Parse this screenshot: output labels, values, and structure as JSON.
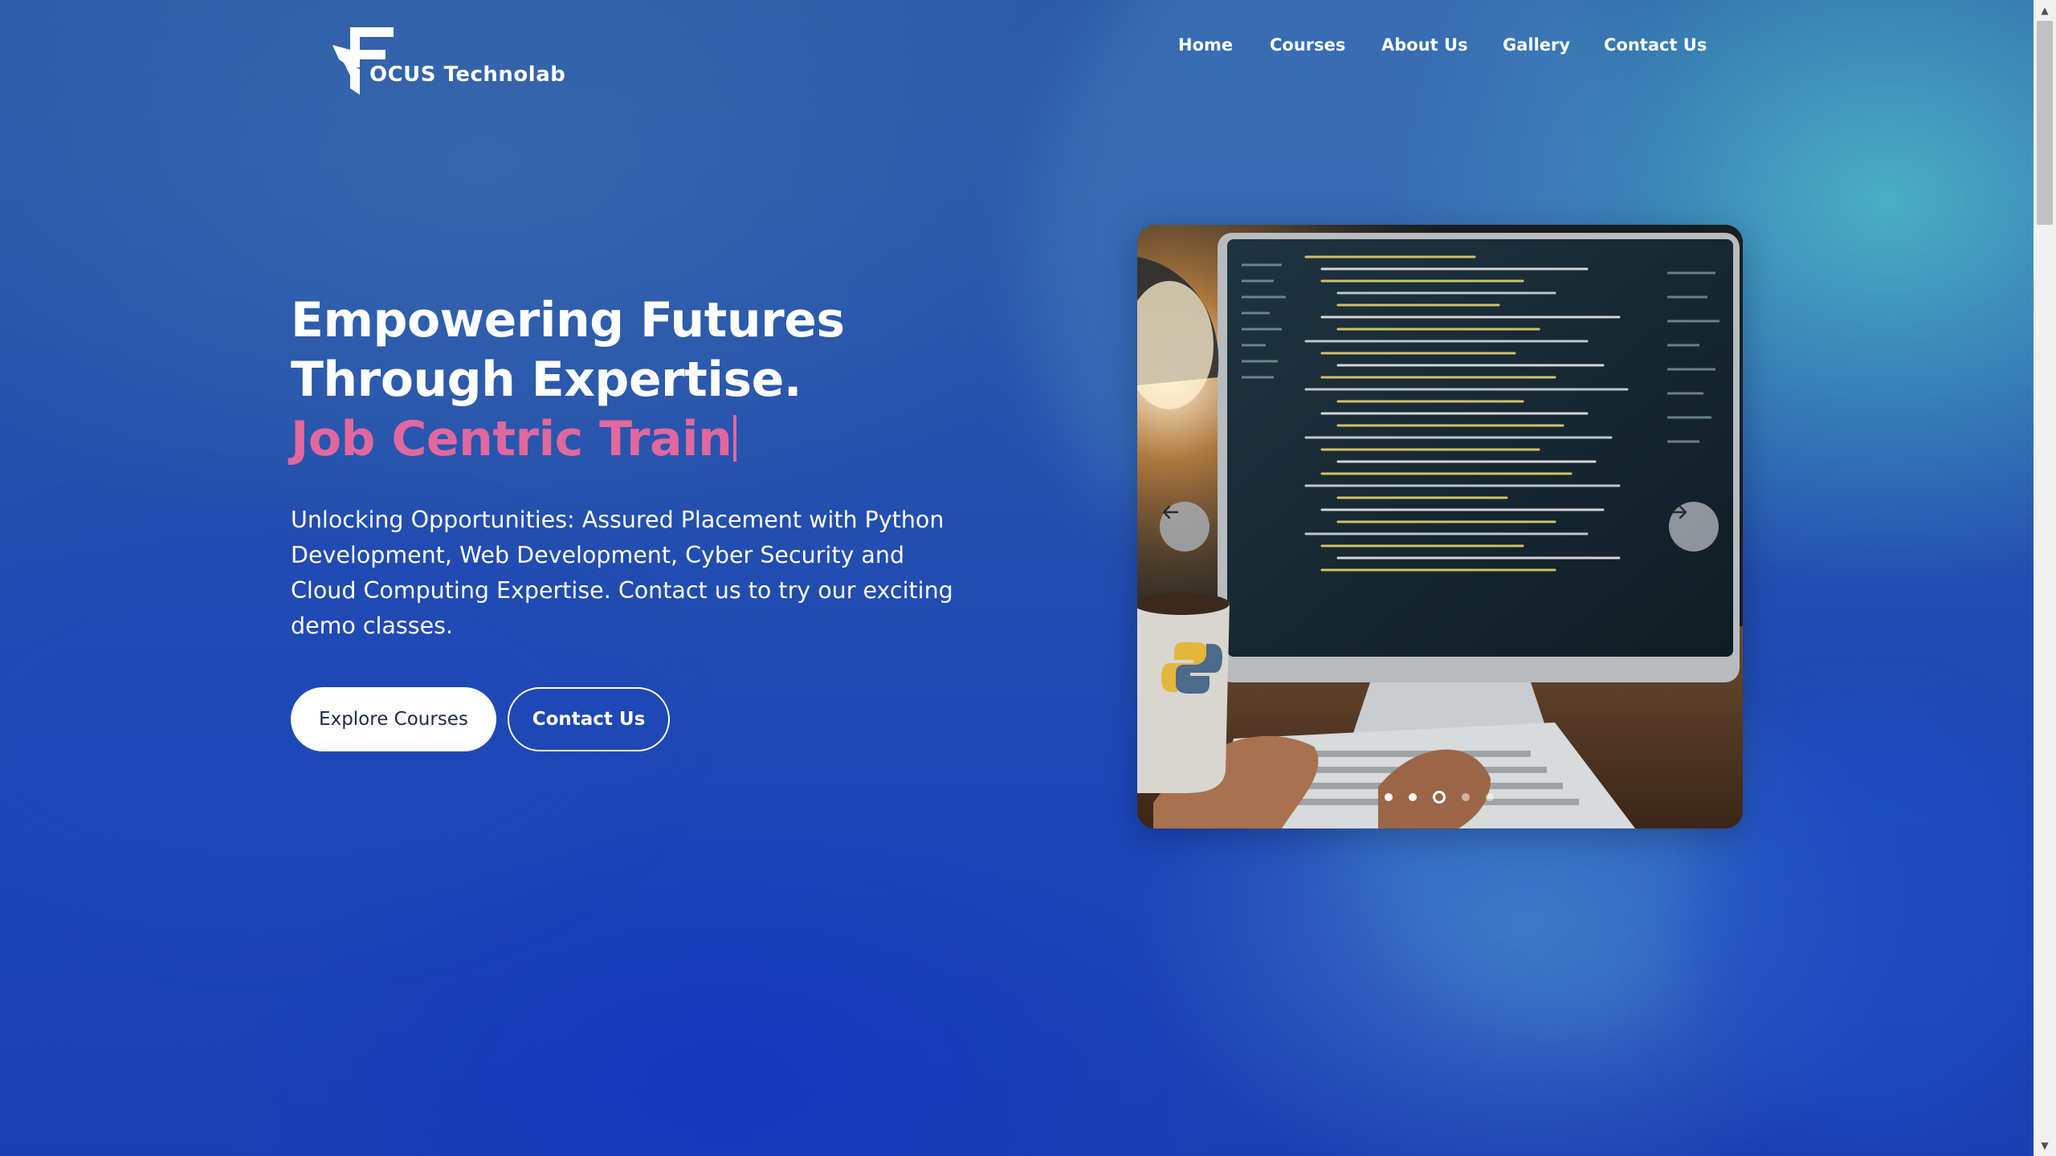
{
  "brand": {
    "name": "OCUS Technolab",
    "logo_letter": "F"
  },
  "nav": {
    "items": [
      {
        "label": "Home"
      },
      {
        "label": "Courses"
      },
      {
        "label": "About Us"
      },
      {
        "label": "Gallery"
      },
      {
        "label": "Contact Us"
      }
    ]
  },
  "hero": {
    "title": "Empowering Futures Through Expertise.",
    "typed_text": "Job Centric Train",
    "description": "Unlocking Opportunities: Assured Placement with Python Development, Web Development, Cyber Security and Cloud Computing Expertise. Contact us to try our exciting demo classes.",
    "explore_label": "Explore Courses",
    "contact_label": "Contact Us"
  },
  "carousel": {
    "prev_icon": "arrow-left-icon",
    "next_icon": "arrow-right-icon",
    "slide_count": 5,
    "active_slide": 3
  },
  "colors": {
    "accent_pink": "#e0689f",
    "background_blue": "#1d46b0",
    "text_white": "#ffffff"
  }
}
